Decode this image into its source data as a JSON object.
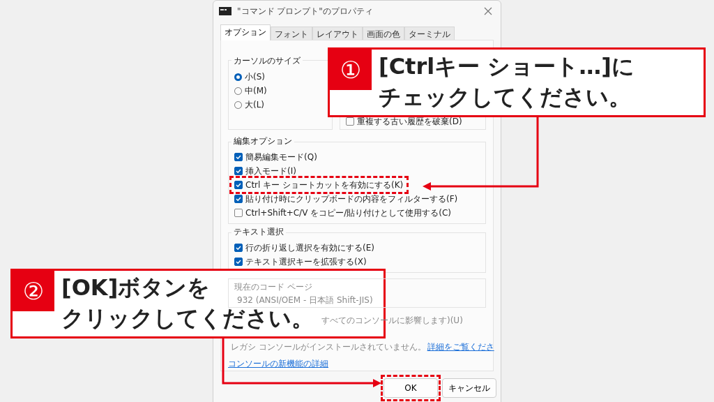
{
  "window": {
    "title": "\"コマンド プロンプト\"のプロパティ"
  },
  "tabs": [
    {
      "label": "オプション",
      "selected": true
    },
    {
      "label": "フォント",
      "selected": false
    },
    {
      "label": "レイアウト",
      "selected": false
    },
    {
      "label": "画面の色",
      "selected": false
    },
    {
      "label": "ターミナル",
      "selected": false
    }
  ],
  "cursor_size": {
    "title": "カーソルのサイズ",
    "options": [
      {
        "label": "小(S)",
        "selected": true
      },
      {
        "label": "中(M)",
        "selected": false
      },
      {
        "label": "大(L)",
        "selected": false
      }
    ]
  },
  "command_history": {
    "checkbox": {
      "label": "重複する古い履歴を破棄(D)",
      "checked": false
    }
  },
  "edit_options": {
    "title": "編集オプション",
    "items": [
      {
        "label": "簡易編集モード(Q)",
        "checked": true,
        "highlighted": false
      },
      {
        "label": "挿入モード(I)",
        "checked": true,
        "highlighted": false
      },
      {
        "label": "Ctrl キー ショートカットを有効にする(K)",
        "checked": true,
        "highlighted": true
      },
      {
        "label": "貼り付け時にクリップボードの内容をフィルターする(F)",
        "checked": true,
        "highlighted": false
      },
      {
        "label": "Ctrl+Shift+C/V をコピー/貼り付けとして使用する(C)",
        "checked": false,
        "highlighted": false
      }
    ]
  },
  "text_selection": {
    "title": "テキスト選択",
    "items": [
      {
        "label": "行の折り返し選択を有効にする(E)",
        "checked": true
      },
      {
        "label": "テキスト選択キーを拡張する(X)",
        "checked": true
      }
    ]
  },
  "code_page": {
    "title": "現在のコード ページ",
    "value": "932   (ANSI/OEM - 日本語 Shift-JIS)"
  },
  "legacy_console": {
    "label": "すべてのコンソールに影響します)(U)",
    "note": "レガシ コンソールがインストールされていません。",
    "link": "詳細をご覧くださ"
  },
  "new_features_link": "コンソールの新機能の詳細",
  "buttons": [
    {
      "label": "OK",
      "highlighted": true
    },
    {
      "label": "キャンセル",
      "highlighted": false
    }
  ],
  "callouts": [
    {
      "number": "①",
      "lines": [
        "[Ctrlキー ショート…]に",
        "チェックしてください。"
      ]
    },
    {
      "number": "②",
      "lines": [
        "[OK]ボタンを",
        "クリックしてください。"
      ]
    }
  ]
}
